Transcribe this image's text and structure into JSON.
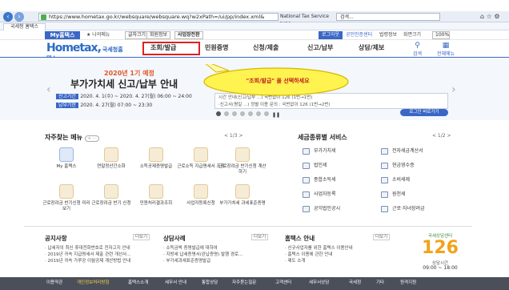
{
  "browser": {
    "url": "https://www.hometax.go.kr/websquare/websquare.wq?w2xPath=/ui/pp/index.xml&",
    "cert": "National Tax Service [KR]",
    "search_placeholder": "검색...",
    "tab_title": "국세청 홈택스"
  },
  "util": {
    "my_tab": "My홈택스",
    "my_info": "나의메뉴",
    "btn_font": "글자크기",
    "btn_member": "회원정보",
    "btn_biz": "사업장전환",
    "login": "로그아웃",
    "cert_center": "공인인증센터",
    "sitemap": "법령정보",
    "lang": "화면크기",
    "zoom": "100%"
  },
  "logo": {
    "main": "Hometax,",
    "sub": "국세청홈택스"
  },
  "menu": {
    "items": [
      "조회/발급",
      "민원증명",
      "신청/제출",
      "신고/납부",
      "상담/제보"
    ],
    "search": "검색",
    "all": "전체메뉴"
  },
  "banner": {
    "year": "2020년 1기 예정",
    "title": "부가가치세 신고/납부 안내",
    "tag1": "신고기간",
    "date1": "2020. 4. 1(수) ~ 2020. 4. 27(월) 06:00 ~ 24:00",
    "tag2": "납부기한",
    "date2": "2020. 4. 27(월) 07:00 ~ 23:30",
    "right_line1": "시간 안내(신고/납부 ...)       국번없이 126 (1번→1번)",
    "right_line2": "·신고서(평일 ...)          정별 이용 문의 : 국번없이 126 (1번→2번)",
    "cta": "로그인 바로가기"
  },
  "callout": {
    "text": "\"조회/발급\" 을 선택하세요"
  },
  "quick": {
    "title": "자주찾는 메뉴",
    "pager": "< 1/3 >",
    "items": [
      "My 홈택스",
      "연말정산간소화",
      "소득공제증명발급",
      "근로소득 지급명세서 조회",
      "근로장려금 반기신청 계산하기",
      "근로장려금 반기신청 미리보기",
      "근로장려금 반기 신청",
      "민원처리결과조회",
      "사업자등록신청",
      "부가가치세 과세표준증명"
    ]
  },
  "tax": {
    "title": "세금종류별 서비스",
    "pager": "< 1/2 >",
    "items": [
      "부가가치세",
      "전자세금계산서",
      "법인세",
      "현금영수증",
      "종합소득세",
      "소비세제",
      "사업자등록",
      "원천세",
      "공익법인공시",
      "근로·자녀장려금"
    ]
  },
  "notice": {
    "title": "공지사항",
    "more": "더보기",
    "items": [
      "· 납세자의 최신 휴대전화번호로 전자고지 안내",
      "· 2019년 귀속 지급명세서 제출 관련 개선사...",
      "· 2019년 귀속 가루공 이월공제 계산방법 안내"
    ]
  },
  "case": {
    "title": "상담사례",
    "more": "더보기",
    "items": [
      "· 소득금액 증명발급에 대하여",
      "· 지방세 납세증명서(완납증명) 발행 경로...",
      "· 부가세과세표준증명발급"
    ]
  },
  "hometax_info": {
    "title": "홈택스 안내",
    "more": "더보기",
    "items": [
      "· 신규사업자를 위한 홈택스 이용안내",
      "· 홈택스 이용에 관한 안내",
      "· 제도 소개"
    ]
  },
  "callcenter": {
    "label": "국세상담센터",
    "number": "126",
    "hours_label": "상담시간",
    "hours": "09:00 ~ 18:00"
  },
  "footer": {
    "items": [
      "이용약관",
      "개인정보처리방침",
      "홈택스소개",
      "세무서 안내",
      "통합상담",
      "자주묻는질문",
      "고객센터",
      "세무서상담",
      "국세청",
      "기타",
      "원격지원"
    ]
  }
}
